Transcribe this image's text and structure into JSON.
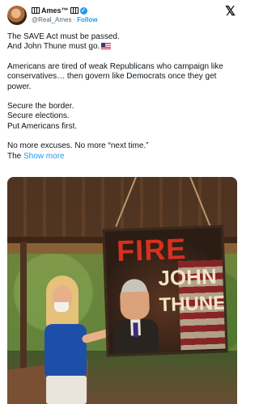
{
  "author": {
    "name": "Ames™",
    "handle": "@Real_Ames",
    "separator": "·",
    "follow_label": "Follow"
  },
  "icons": {
    "avatar": "profile-photo",
    "piano": "piano-keys-emoji",
    "verified": "verified-badge",
    "close": "x-logo",
    "flag": "us-flag-emoji"
  },
  "colors": {
    "accent": "#1d9bf0",
    "text": "#0f1419",
    "muted": "#536471"
  },
  "tweet": {
    "line1": "The SAVE Act must be passed.",
    "line2": "And John Thune must go.",
    "line3": "Americans are tired of weak Republicans who campaign like conservatives… then govern like Democrats once they get power.",
    "line4": "Secure the border.",
    "line5": "Secure elections.",
    "line6": "Put Americans first.",
    "line7": "No more excuses. No more “next time.”",
    "line8_start": "The",
    "show_more": "Show more"
  },
  "image": {
    "sign_line1": "FIRE",
    "sign_line2": "JOHN",
    "sign_line3": "THUNE"
  }
}
